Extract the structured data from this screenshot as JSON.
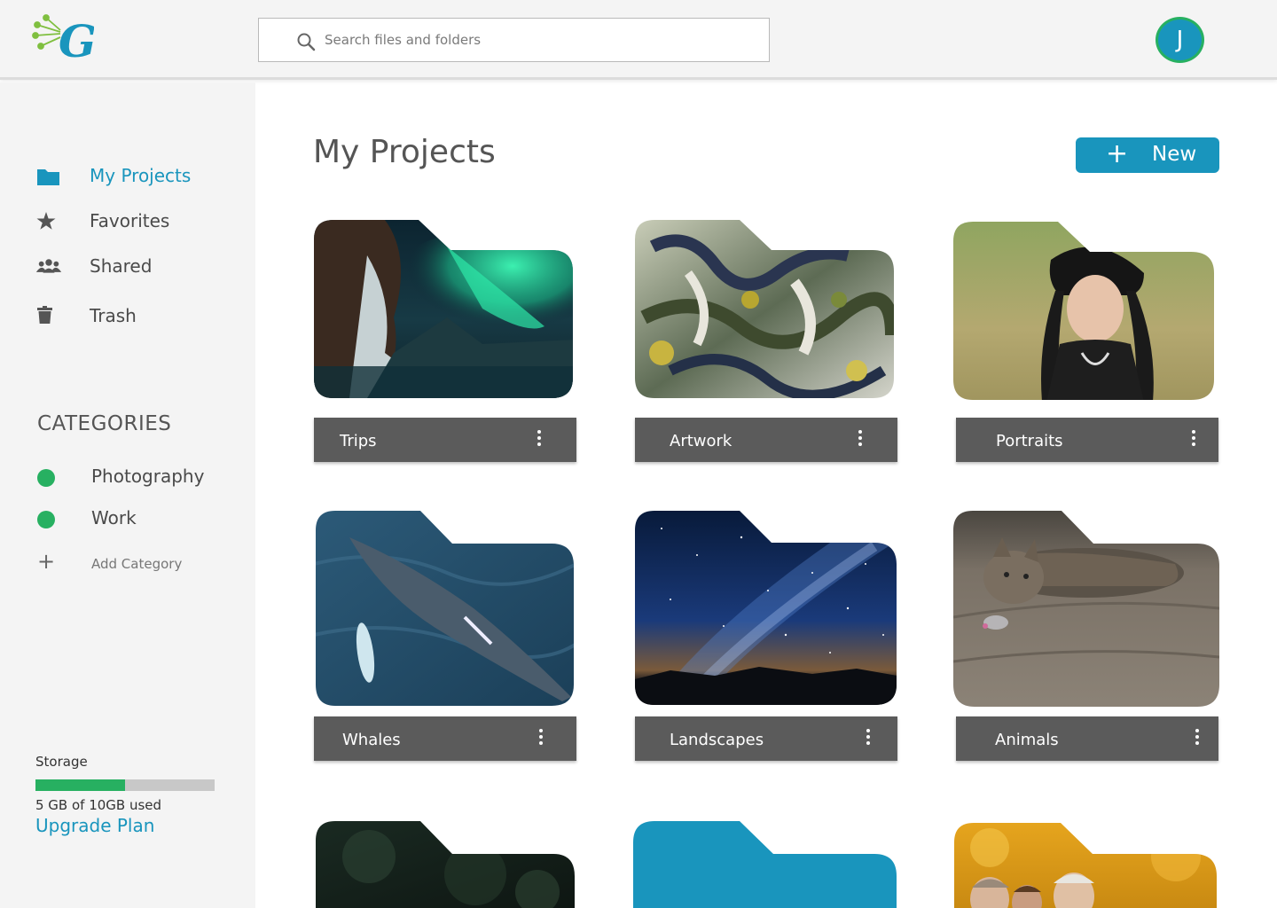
{
  "header": {
    "logo_icon": "gliffy-g-logo-icon",
    "search_placeholder": "Search files and folders",
    "avatar_initial": "J",
    "accent_color": "#1995bd",
    "ring_color": "#27b061"
  },
  "sidebar": {
    "nav": [
      {
        "label": "My Projects",
        "icon": "folder-icon",
        "active": true
      },
      {
        "label": "Favorites",
        "icon": "star-icon",
        "active": false
      },
      {
        "label": "Shared",
        "icon": "users-icon",
        "active": false
      },
      {
        "label": "Trash",
        "icon": "trash-icon",
        "active": false
      }
    ],
    "categories_title": "CATEGORIES",
    "categories": [
      {
        "label": "Photography",
        "color": "#27b061"
      },
      {
        "label": "Work",
        "color": "#27b061"
      }
    ],
    "add_category_label": "Add Category",
    "storage": {
      "label": "Storage",
      "used_fraction": 0.5,
      "used_text": "5 GB of 10GB used",
      "upgrade_label": "Upgrade Plan"
    }
  },
  "main": {
    "title": "My Projects",
    "new_button_label": "New",
    "folders": [
      {
        "name": "Trips",
        "thumbnail": "aurora-ice-cave"
      },
      {
        "name": "Artwork",
        "thumbnail": "abstract-painting"
      },
      {
        "name": "Portraits",
        "thumbnail": "woman-portrait"
      },
      {
        "name": "Whales",
        "thumbnail": "whale-aerial"
      },
      {
        "name": "Landscapes",
        "thumbnail": "night-sky-milky-way"
      },
      {
        "name": "Animals",
        "thumbnail": "cat-with-toy"
      },
      {
        "name": "",
        "thumbnail": "dark-forest"
      },
      {
        "name": "",
        "thumbnail": "blue-folder"
      },
      {
        "name": "",
        "thumbnail": "family-autumn"
      }
    ]
  }
}
